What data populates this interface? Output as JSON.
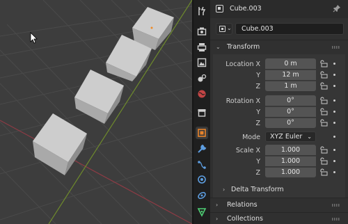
{
  "header": {
    "object_title": "Cube.003"
  },
  "object_name": "Cube.003",
  "transform": {
    "label": "Transform",
    "location": {
      "label_x": "Location X",
      "label_y": "Y",
      "label_z": "Z",
      "x": "0 m",
      "y": "12 m",
      "z": "1 m"
    },
    "rotation": {
      "label_x": "Rotation X",
      "label_y": "Y",
      "label_z": "Z",
      "x": "0°",
      "y": "0°",
      "z": "0°"
    },
    "mode": {
      "label": "Mode",
      "value": "XYZ Euler"
    },
    "scale": {
      "label_x": "Scale X",
      "label_y": "Y",
      "label_z": "Z",
      "x": "1.000",
      "y": "1.000",
      "z": "1.000"
    },
    "delta_transform_label": "Delta Transform"
  },
  "panels": {
    "relations": "Relations",
    "collections": "Collections"
  },
  "tabs": [
    "tool-icon",
    "render-icon",
    "output-icon",
    "view-layer-icon",
    "scene-icon",
    "world-icon",
    "collection-icon",
    "object-icon",
    "modifier-icon",
    "particles-icon",
    "physics-icon",
    "constraints-icon",
    "data-icon"
  ],
  "colors": {
    "viewport_bg": "#3d3d3d",
    "panel_bg": "#303030",
    "field_bg": "#545454",
    "active_tab_accent": "#e8832a"
  }
}
